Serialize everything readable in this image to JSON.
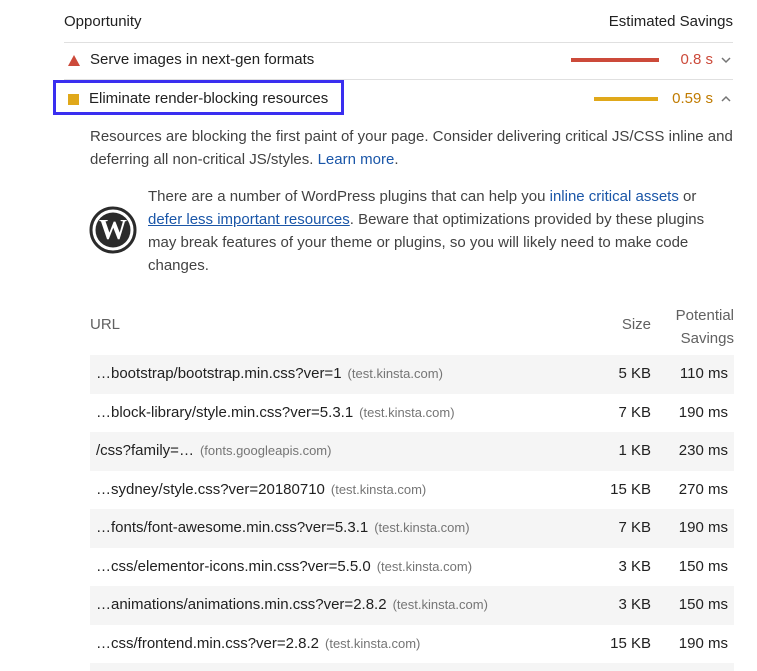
{
  "header": {
    "opportunity": "Opportunity",
    "estimated_savings": "Estimated Savings"
  },
  "audits": [
    {
      "title": "Serve images in next-gen formats",
      "value": "0.8 s",
      "status": "fail",
      "color": "#cc4a3a",
      "bar_fraction": 1.0,
      "expanded": false
    },
    {
      "title": "Eliminate render-blocking resources",
      "value": "0.59 s",
      "status": "average",
      "color": "#e0a81a",
      "bar_fraction": 0.74,
      "expanded": true
    }
  ],
  "description": {
    "text": "Resources are blocking the first paint of your page. Consider delivering critical JS/CSS inline and deferring all non-critical JS/styles.",
    "link": "Learn more"
  },
  "wordpress_note": {
    "part1": "There are a number of WordPress plugins that can help you ",
    "link1": "inline critical assets",
    "part2": " or ",
    "link2": "defer less important resources",
    "part3": ". Beware that optimizations provided by these plugins may break features of your theme or plugins, so you will likely need to make code changes."
  },
  "table": {
    "columns": {
      "url": "URL",
      "size": "Size",
      "savings_line1": "Potential",
      "savings_line2": "Savings"
    },
    "rows": [
      {
        "url": "…bootstrap/bootstrap.min.css?ver=1",
        "host": "(test.kinsta.com)",
        "size": "5 KB",
        "savings": "110 ms"
      },
      {
        "url": "…block-library/style.min.css?ver=5.3.1",
        "host": "(test.kinsta.com)",
        "size": "7 KB",
        "savings": "190 ms"
      },
      {
        "url": "/css?family=…",
        "host": "(fonts.googleapis.com)",
        "size": "1 KB",
        "savings": "230 ms"
      },
      {
        "url": "…sydney/style.css?ver=20180710",
        "host": "(test.kinsta.com)",
        "size": "15 KB",
        "savings": "270 ms"
      },
      {
        "url": "…fonts/font-awesome.min.css?ver=5.3.1",
        "host": "(test.kinsta.com)",
        "size": "7 KB",
        "savings": "190 ms"
      },
      {
        "url": "…css/elementor-icons.min.css?ver=5.5.0",
        "host": "(test.kinsta.com)",
        "size": "3 KB",
        "savings": "150 ms"
      },
      {
        "url": "…animations/animations.min.css?ver=2.8.2",
        "host": "(test.kinsta.com)",
        "size": "3 KB",
        "savings": "150 ms"
      },
      {
        "url": "…css/frontend.min.css?ver=2.8.2",
        "host": "(test.kinsta.com)",
        "size": "15 KB",
        "savings": "190 ms"
      }
    ]
  },
  "icons": {
    "fail": "triangle-icon",
    "average": "square-icon",
    "wordpress": "wordpress-logo-icon"
  }
}
